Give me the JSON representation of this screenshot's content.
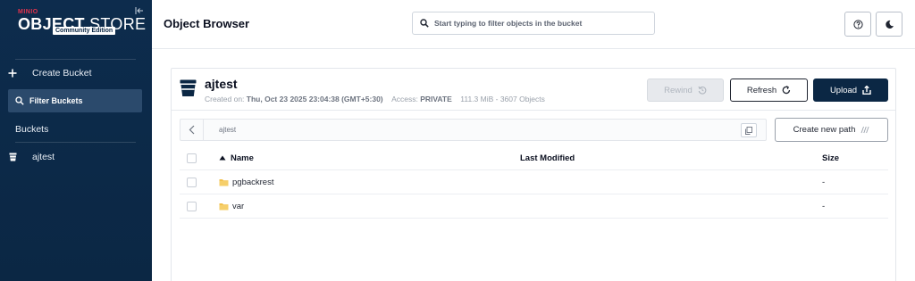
{
  "brand": {
    "small": "MINIO",
    "title_bold": "OBJECT",
    "title_light": "STORE",
    "edition": "Community Edition"
  },
  "sidebar": {
    "create_bucket": "Create Bucket",
    "filter_placeholder": "Filter Buckets",
    "buckets_label": "Buckets",
    "buckets": [
      {
        "name": "ajtest"
      }
    ]
  },
  "header": {
    "title": "Object Browser",
    "search_placeholder": "Start typing to filter objects in the bucket"
  },
  "bucket": {
    "name": "ajtest",
    "created_label": "Created on:",
    "created_value": "Thu, Oct 23 2025 23:04:38 (GMT+5:30)",
    "access_label": "Access:",
    "access_value": "PRIVATE",
    "stats": "111.3 MiB - 3607 Objects",
    "rewind_label": "Rewind",
    "refresh_label": "Refresh",
    "upload_label": "Upload"
  },
  "path": {
    "current": "ajtest",
    "create_new_path_label": "Create new path"
  },
  "table": {
    "columns": {
      "name": "Name",
      "modified": "Last Modified",
      "size": "Size"
    },
    "rows": [
      {
        "name": "pgbackrest",
        "modified": "",
        "size": "-"
      },
      {
        "name": "var",
        "modified": "",
        "size": "-"
      }
    ]
  },
  "colors": {
    "sidebar_bg": "#0b2744",
    "accent_red": "#e3334d",
    "primary": "#0b2744"
  }
}
